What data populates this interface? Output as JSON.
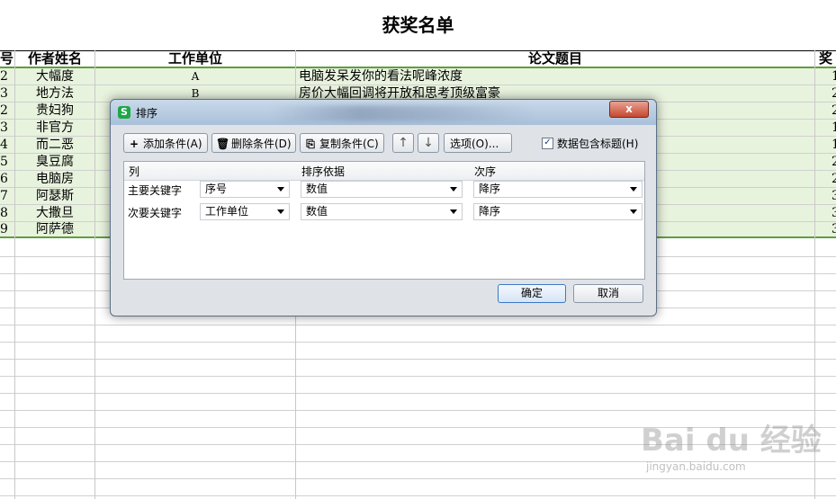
{
  "sheet": {
    "title": "获奖名单",
    "headers": {
      "col_a": "号",
      "col_b": "作者姓名",
      "col_c": "工作单位",
      "col_d": "论文题目",
      "col_e": "奖"
    },
    "rows": [
      {
        "a": "2",
        "b": "大幅度",
        "c": "A",
        "d": "电脑发呆发你的看法呢峰浓度",
        "e": "1"
      },
      {
        "a": "3",
        "b": "地方法",
        "c": "B",
        "d": "房价大幅回调将开放和思考顶级富豪",
        "e": "2"
      },
      {
        "a": "2",
        "b": "贵妇狗",
        "c": "",
        "d": "",
        "e": "2"
      },
      {
        "a": "3",
        "b": "非官方",
        "c": "",
        "d": "",
        "e": "1"
      },
      {
        "a": "4",
        "b": "而二恶",
        "c": "",
        "d": "",
        "e": "1"
      },
      {
        "a": "5",
        "b": "臭豆腐",
        "c": "",
        "d": "",
        "e": "2"
      },
      {
        "a": "6",
        "b": "电脑房",
        "c": "",
        "d": "",
        "e": "2"
      },
      {
        "a": "7",
        "b": "阿瑟斯",
        "c": "",
        "d": "",
        "e": "3"
      },
      {
        "a": "8",
        "b": "大撒旦",
        "c": "",
        "d": "",
        "e": "3"
      },
      {
        "a": "9",
        "b": "阿萨德",
        "c": "",
        "d": "",
        "e": "3"
      }
    ]
  },
  "dialog": {
    "title": "排序",
    "close_label": "x",
    "toolbar": {
      "add_condition": "添加条件(A)",
      "delete_condition": "删除条件(D)",
      "copy_condition": "复制条件(C)",
      "move_up": "↑",
      "move_down": "↓",
      "options": "选项(O)...",
      "has_header_label": "数据包含标题(H)",
      "has_header_checked": "✓"
    },
    "grid": {
      "col_column": "列",
      "col_sort_on": "排序依据",
      "col_order": "次序",
      "rows": [
        {
          "label": "主要关键字",
          "column": "序号",
          "sort_on": "数值",
          "order": "降序"
        },
        {
          "label": "次要关键字",
          "column": "工作单位",
          "sort_on": "数值",
          "order": "降序"
        }
      ]
    },
    "ok": "确定",
    "cancel": "取消"
  },
  "watermark": {
    "brand": "Bai du 经验",
    "url": "jingyan.baidu.com"
  },
  "colors": {
    "selection_fill": "#e8f3de",
    "selection_border": "#5f9e3f",
    "dialog_title": "#b5c9de",
    "app_icon": "#1fa648"
  }
}
